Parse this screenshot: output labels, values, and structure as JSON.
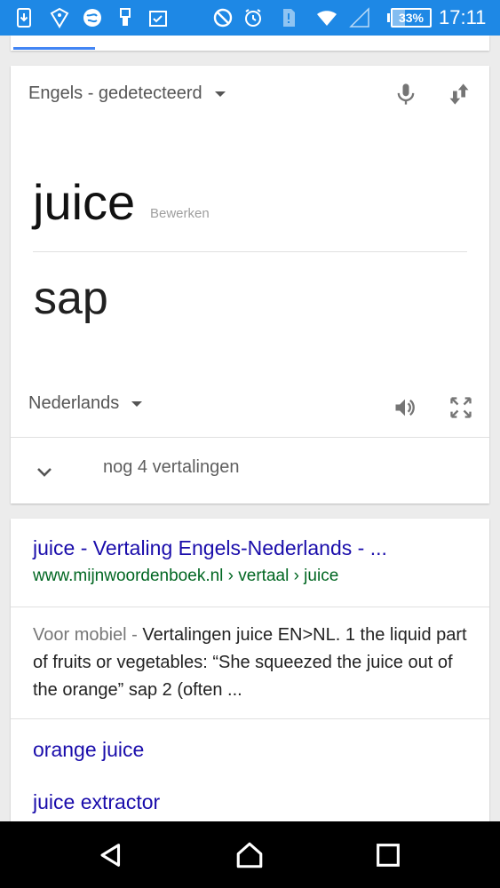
{
  "status_bar": {
    "battery": "33%",
    "battery_level": 0.33,
    "time": "17:11",
    "icons": [
      "download-icon",
      "shield-icon",
      "globe-icon",
      "usb-icon",
      "clipboard-check-icon",
      "do-not-disturb-icon",
      "alarm-icon",
      "sim-alert-icon",
      "wifi-icon",
      "signal-icon",
      "battery-icon"
    ]
  },
  "translation_card": {
    "source_language": "Engels - gedetecteerd",
    "source_text": "juice",
    "edit_label": "Bewerken",
    "target_language": "Nederlands",
    "translation": "sap",
    "more_translations": "nog 4 vertalingen",
    "icons": [
      "microphone-icon",
      "swap-languages-icon",
      "speaker-icon",
      "fullscreen-icon",
      "chevron-down-icon"
    ]
  },
  "search_result": {
    "title": "juice - Vertaling Engels-Nederlands - ...",
    "url": "www.mijnwoordenboek.nl › vertaal › juice",
    "snippet_prefix": "Voor mobiel - ",
    "snippet": "Vertalingen juice EN>NL. 1 the liquid part of fruits or vegetables: “She squeezed the juice out of the orange” sap 2 (often ...",
    "related": [
      "orange juice",
      "juice extractor"
    ]
  },
  "nav_bar": {
    "icons": [
      "back-icon",
      "home-icon",
      "recents-icon"
    ]
  },
  "colors": {
    "status_bar": "#1e88e5",
    "link": "#1a0dab",
    "url": "#006621",
    "accent": "#4285f4"
  }
}
